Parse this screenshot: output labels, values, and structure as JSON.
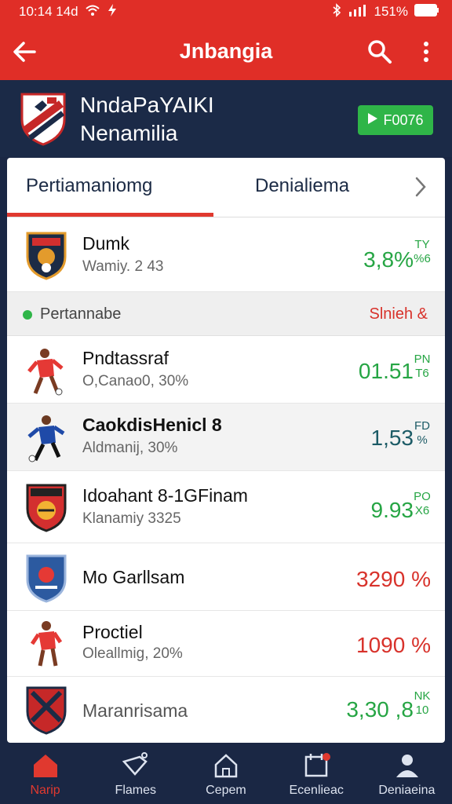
{
  "status_bar": {
    "left_text": "10:14 14d",
    "battery": "151%"
  },
  "app_bar": {
    "title": "Jnbangia",
    "back_icon": "arrow-left-icon",
    "search_icon": "search-icon",
    "more_icon": "more-vertical-icon"
  },
  "team_header": {
    "name_line1": "NndaPaYAIKI",
    "name_line2": "Nenamilia",
    "live_button": "F0076"
  },
  "tabs": [
    {
      "label": "Pertiamaniomg",
      "active": true
    },
    {
      "label": "Denialiema",
      "active": false
    }
  ],
  "rows": [
    {
      "name": "Dumk",
      "sub": "Wamiy. 2 43",
      "value": "3,8%",
      "unit_top": "TY",
      "unit_bottom": "%6",
      "color": "green",
      "icon": "club-crest-icon"
    },
    {
      "name": "Pndtassraf",
      "sub": "O,Canao0, 30%",
      "value": "01.51",
      "unit_top": "PN",
      "unit_bottom": "T6",
      "color": "green",
      "icon": "player-red-icon"
    },
    {
      "name": "CaokdisHenicl 8",
      "sub": "Aldmanij, 30%",
      "value": "1,53",
      "unit_top": "FD",
      "unit_bottom": "%",
      "color": "teal",
      "icon": "player-blue-icon"
    },
    {
      "name": "Idoahant 8-1GFinam",
      "sub": "Klanamiy 3325",
      "value": "9.93",
      "unit_top": "PO",
      "unit_bottom": "X6",
      "color": "green",
      "icon": "club-crest-icon"
    },
    {
      "name": "Mo Garllsam",
      "sub": "",
      "value": "3290 %",
      "unit_top": "",
      "unit_bottom": "",
      "color": "red",
      "icon": "club-shield-blue-icon"
    },
    {
      "name": "Proctiel",
      "sub": "Oleallmig, 20%",
      "value": "1090 %",
      "unit_top": "",
      "unit_bottom": "",
      "color": "red",
      "icon": "player-red-icon"
    },
    {
      "name": "Maranrisama",
      "sub": "",
      "value": "3,30 ,8",
      "unit_top": "NK",
      "unit_bottom": "10",
      "color": "green",
      "icon": "club-shield-red-icon"
    }
  ],
  "section_header": {
    "label": "Pertannabe",
    "right": "Slnieh &"
  },
  "bottom_nav": [
    {
      "label": "Narip",
      "icon": "home-icon",
      "active": true
    },
    {
      "label": "Flames",
      "icon": "tag-icon",
      "active": false
    },
    {
      "label": "Cepem",
      "icon": "house-icon",
      "active": false
    },
    {
      "label": "Ecenlieac",
      "icon": "calendar-icon",
      "active": false
    },
    {
      "label": "Deniaeina",
      "icon": "profile-icon",
      "active": false
    }
  ]
}
